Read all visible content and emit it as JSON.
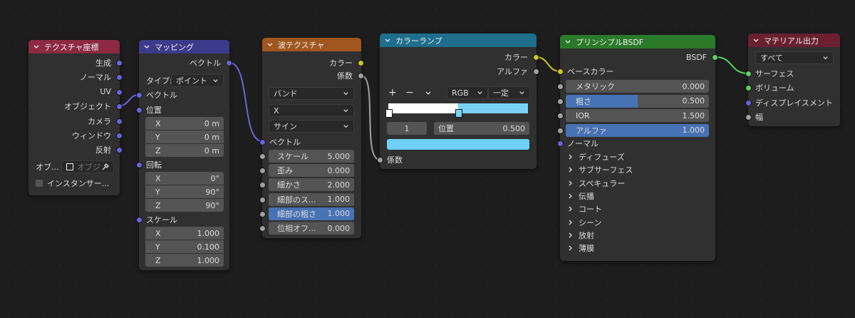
{
  "colors": {
    "vector_socket": "#6a64d8",
    "color_socket": "#c7c72b",
    "float_socket": "#a1a1a1",
    "shader_socket": "#5fcf65",
    "texcoord_header": "#8c2a44",
    "mapping_header": "#3c3a8a",
    "wave_header": "#a0561e",
    "colorramp_header": "#1e6e8c",
    "bsdf_header": "#2a7a2a",
    "output_header": "#6a2030",
    "highlight_field": "#4772b3"
  },
  "texcoord": {
    "title": "テクスチャ座標",
    "outputs": [
      "生成",
      "ノーマル",
      "UV",
      "オブジェクト",
      "カメラ",
      "ウィンドウ",
      "反射"
    ],
    "object_label": "オブ...",
    "object_placeholder": "オブジ",
    "instancer_label": "インスタンサー..."
  },
  "mapping": {
    "title": "マッピング",
    "output": "ベクトル",
    "type_label": "タイプ:",
    "type_value": "ポイント",
    "vector_input": "ベクトル",
    "location_label": "位置",
    "location": [
      {
        "axis": "X",
        "value": "0 m"
      },
      {
        "axis": "Y",
        "value": "0 m"
      },
      {
        "axis": "Z",
        "value": "0 m"
      }
    ],
    "rotation_label": "回転",
    "rotation": [
      {
        "axis": "X",
        "value": "0°"
      },
      {
        "axis": "Y",
        "value": "90°"
      },
      {
        "axis": "Z",
        "value": "90°"
      }
    ],
    "scale_label": "スケール",
    "scale": [
      {
        "axis": "X",
        "value": "1.000"
      },
      {
        "axis": "Y",
        "value": "0.100"
      },
      {
        "axis": "Z",
        "value": "1.000"
      }
    ]
  },
  "wave": {
    "title": "波テクスチャ",
    "outputs": [
      "カラー",
      "係数"
    ],
    "wave_type": "バンド",
    "direction": "X",
    "profile": "サイン",
    "vector_input": "ベクトル",
    "params": [
      {
        "label": "スケール",
        "value": "5.000"
      },
      {
        "label": "歪み",
        "value": "0.000"
      },
      {
        "label": "細かさ",
        "value": "2.000"
      },
      {
        "label": "細部のス...",
        "value": "1.000"
      },
      {
        "label": "細部の粗さ",
        "value": "1.000"
      },
      {
        "label": "位相オフ...",
        "value": "0.000"
      }
    ]
  },
  "colorramp": {
    "title": "カラーランプ",
    "outputs": [
      "カラー",
      "アルファ"
    ],
    "add_label": "+",
    "remove_label": "−",
    "color_mode": "RGB",
    "interpolation": "一定",
    "stop_index": "1",
    "pos_label": "位置",
    "pos_value": "0.500",
    "ramp_colors": [
      "#ffffff",
      "#79d2f5"
    ],
    "ramp_split": 0.5,
    "active_color": "#6fd0fa",
    "fac_input": "係数"
  },
  "bsdf": {
    "title": "プリンシプルBSDF",
    "output": "BSDF",
    "base_color_label": "ベースカラー",
    "fields": [
      {
        "label": "メタリック",
        "value": "0.000",
        "fill": 0.0
      },
      {
        "label": "粗さ",
        "value": "0.500",
        "fill": 0.5
      },
      {
        "label": "IOR",
        "value": "1.500",
        "fill": 0.0
      },
      {
        "label": "アルファ",
        "value": "1.000",
        "fill": 1.0
      }
    ],
    "normal_label": "ノーマル",
    "panels": [
      "ディフューズ",
      "サブサーフェス",
      "スペキュラー",
      "伝播",
      "コート",
      "シーン",
      "放射",
      "薄膜"
    ]
  },
  "output": {
    "title": "マテリアル出力",
    "target": "すべて",
    "inputs": [
      "サーフェス",
      "ボリューム",
      "ディスプレイスメント",
      "幅"
    ]
  }
}
